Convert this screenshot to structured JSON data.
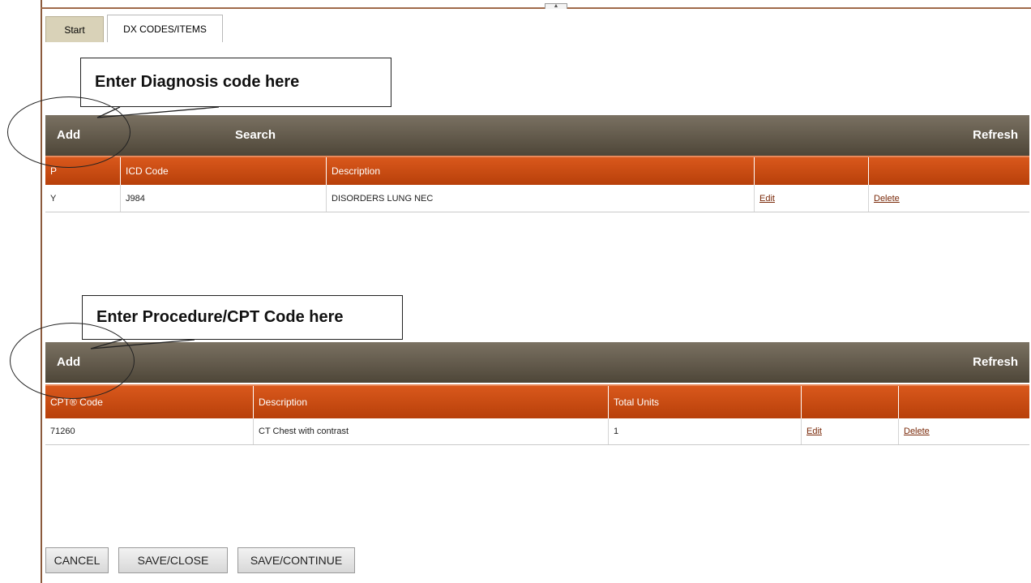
{
  "tabs": [
    {
      "label": "Start"
    },
    {
      "label": "DX CODES/ITEMS"
    }
  ],
  "callouts": {
    "diagnosis": "Enter Diagnosis code here",
    "procedure": "Enter Procedure/CPT Code here"
  },
  "diagnosis_panel": {
    "add_label": "Add",
    "search_label": "Search",
    "refresh_label": "Refresh",
    "columns": [
      "P",
      "ICD Code",
      "Description",
      "",
      ""
    ],
    "rows": [
      {
        "p": "Y",
        "icd_code": "J984",
        "description": "DISORDERS LUNG NEC",
        "edit": "Edit",
        "delete": "Delete"
      }
    ]
  },
  "procedure_panel": {
    "add_label": "Add",
    "refresh_label": "Refresh",
    "columns": [
      "CPT® Code",
      "Description",
      "Total Units",
      "",
      ""
    ],
    "rows": [
      {
        "cpt_code": "71260",
        "description": "CT Chest with contrast",
        "total_units": "1",
        "edit": "Edit",
        "delete": "Delete"
      }
    ]
  },
  "buttons": {
    "cancel": "CANCEL",
    "save_close": "SAVE/CLOSE",
    "save_continue": "SAVE/CONTINUE"
  },
  "colors": {
    "header_bar": "#5f574a",
    "table_header": "#c94a12",
    "link": "#7a2a0a",
    "frame": "#8b5a3c"
  }
}
